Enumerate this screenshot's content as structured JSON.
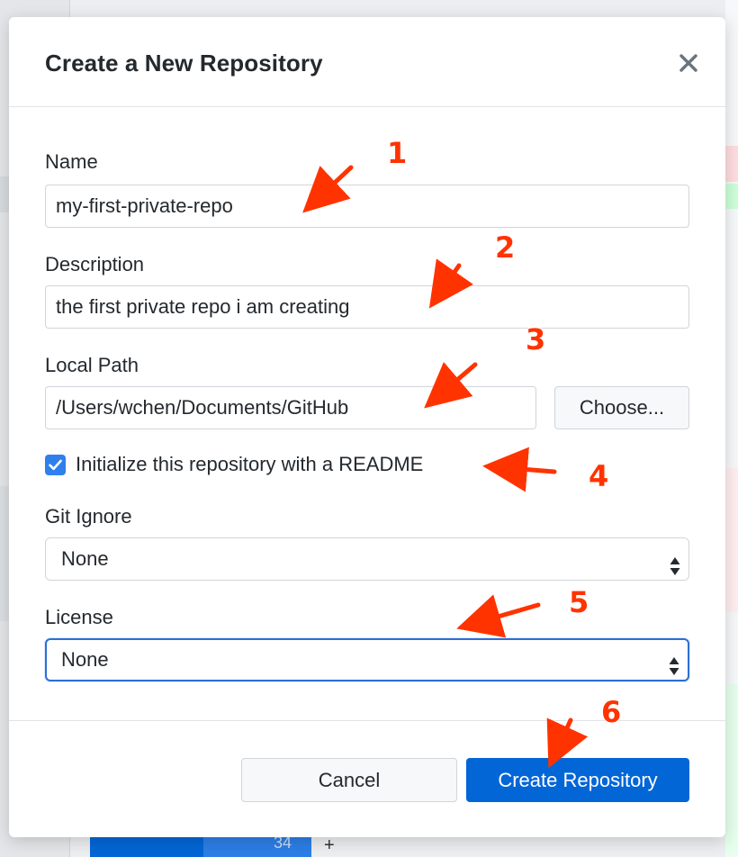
{
  "dialog": {
    "title": "Create a New Repository",
    "close_icon": "close-icon"
  },
  "form": {
    "name_label": "Name",
    "name_value": "my-first-private-repo",
    "description_label": "Description",
    "description_value": "the first private repo i am creating",
    "local_path_label": "Local Path",
    "local_path_value": "/Users/wchen/Documents/GitHub",
    "choose_button": "Choose...",
    "readme_checkbox_label": "Initialize this repository with a README",
    "readme_checked": true,
    "git_ignore_label": "Git Ignore",
    "git_ignore_value": "None",
    "license_label": "License",
    "license_value": "None"
  },
  "footer": {
    "cancel_button": "Cancel",
    "create_button": "Create Repository"
  },
  "annotations": {
    "step_numbers": [
      "1",
      "2",
      "3",
      "4",
      "5",
      "6"
    ],
    "color": "#ff3300"
  },
  "background": {
    "bottom_number": "34",
    "plus": "+"
  },
  "colors": {
    "primary_button": "#0366d6",
    "checkbox": "#2f80ed",
    "focus_border": "#2b6fd6"
  }
}
